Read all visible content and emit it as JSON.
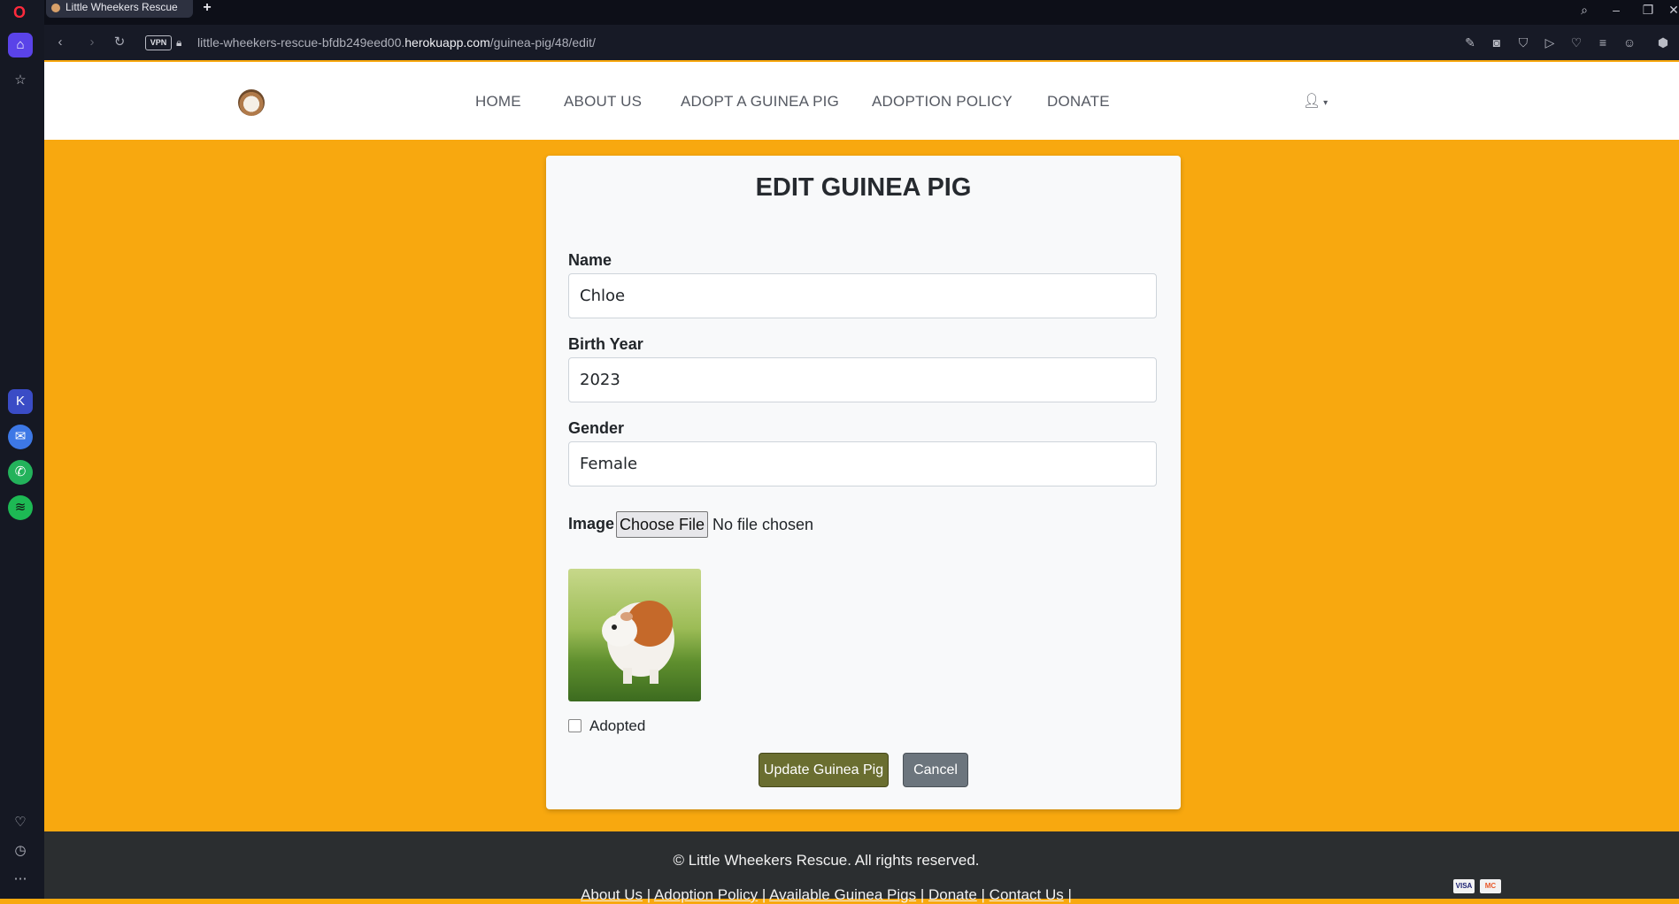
{
  "browser": {
    "tab_title": "Little Wheekers Rescue",
    "url_prefix": "little-wheekers-rescue-bfdb249eed00.",
    "url_domain": "herokuapp.com",
    "url_path": "/guinea-pig/48/edit/",
    "vpn_label": "VPN"
  },
  "nav": {
    "items": [
      "HOME",
      "ABOUT US",
      "ADOPT A GUINEA PIG",
      "ADOPTION POLICY",
      "DONATE"
    ]
  },
  "form": {
    "title": "EDIT GUINEA PIG",
    "name_label": "Name",
    "name_value": "Chloe",
    "birth_label": "Birth Year",
    "birth_value": "2023",
    "gender_label": "Gender",
    "gender_value": "Female",
    "image_label": "Image",
    "choose_file": "Choose File",
    "no_file": "No file chosen",
    "adopted_label": "Adopted",
    "adopted_checked": false,
    "update_button": "Update Guinea Pig",
    "cancel_button": "Cancel"
  },
  "footer": {
    "copyright": "© Little Wheekers Rescue. All rights reserved.",
    "links": [
      "About Us",
      "Adoption Policy",
      "Available Guinea Pigs",
      "Donate",
      "Contact Us"
    ],
    "payment": [
      "VISA",
      "MC"
    ]
  },
  "colors": {
    "page_bg": "#f8a80f",
    "update_button": "#6a6e30",
    "cancel_button": "#6c757d"
  }
}
